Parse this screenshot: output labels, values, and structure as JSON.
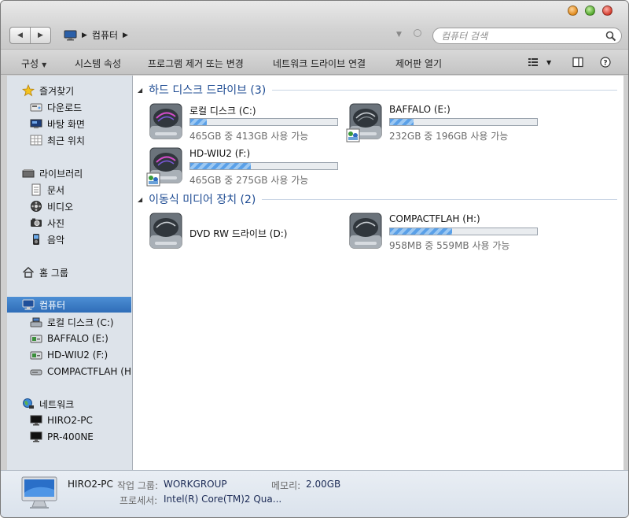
{
  "window": {
    "controls": [
      "minimize",
      "maximize",
      "close"
    ]
  },
  "address": {
    "location": "컴퓨터",
    "search_placeholder": "컴퓨터 검색"
  },
  "toolbar": {
    "organize": "구성",
    "system_properties": "시스템 속성",
    "uninstall": "프로그램 제거 또는 변경",
    "map_drive": "네트워크 드라이브 연결",
    "control_panel": "제어판 열기"
  },
  "sidebar": {
    "favorites": {
      "label": "즐겨찾기",
      "items": [
        "다운로드",
        "바탕 화면",
        "최근 위치"
      ]
    },
    "libraries": {
      "label": "라이브러리",
      "items": [
        "문서",
        "비디오",
        "사진",
        "음악"
      ]
    },
    "homegroup": {
      "label": "홈 그룹"
    },
    "computer": {
      "label": "컴퓨터",
      "items": [
        "로컬 디스크 (C:)",
        "BAFFALO (E:)",
        "HD-WIU2 (F:)",
        "COMPACTFLAH (H:)"
      ]
    },
    "network": {
      "label": "네트워크",
      "items": [
        "HIRO2-PC",
        "PR-400NE"
      ]
    }
  },
  "groups": {
    "hard_disks": {
      "title": "하드 디스크 드라이브 (3)",
      "drives": [
        {
          "name": "로컬 디스크 (C:)",
          "info": "465GB 중 413GB 사용 가능",
          "used_fraction": 0.11
        },
        {
          "name": "BAFFALO (E:)",
          "info": "232GB 중 196GB 사용 가능",
          "used_fraction": 0.16
        },
        {
          "name": "HD-WIU2 (F:)",
          "info": "465GB 중 275GB 사용 가능",
          "used_fraction": 0.41
        }
      ]
    },
    "removable": {
      "title": "이동식 미디어 장치 (2)",
      "drives": [
        {
          "name": "DVD RW 드라이브 (D:)"
        },
        {
          "name": "COMPACTFLAH (H:)",
          "info": "958MB 중 559MB 사용 가능",
          "used_fraction": 0.42
        }
      ]
    }
  },
  "details": {
    "computer_name": "HIRO2-PC",
    "workgroup_label": "작업 그룹:",
    "workgroup_value": "WORKGROUP",
    "memory_label": "메모리:",
    "memory_value": "2.00GB",
    "processor_label": "프로세서:",
    "processor_value": "Intel(R) Core(TM)2 Qua..."
  },
  "colors": {
    "group_title": "#1f4c93",
    "sidebar_bg": "#dde3ea",
    "selection": "#2f6db8",
    "bar_fill": "#5aa0e8"
  }
}
